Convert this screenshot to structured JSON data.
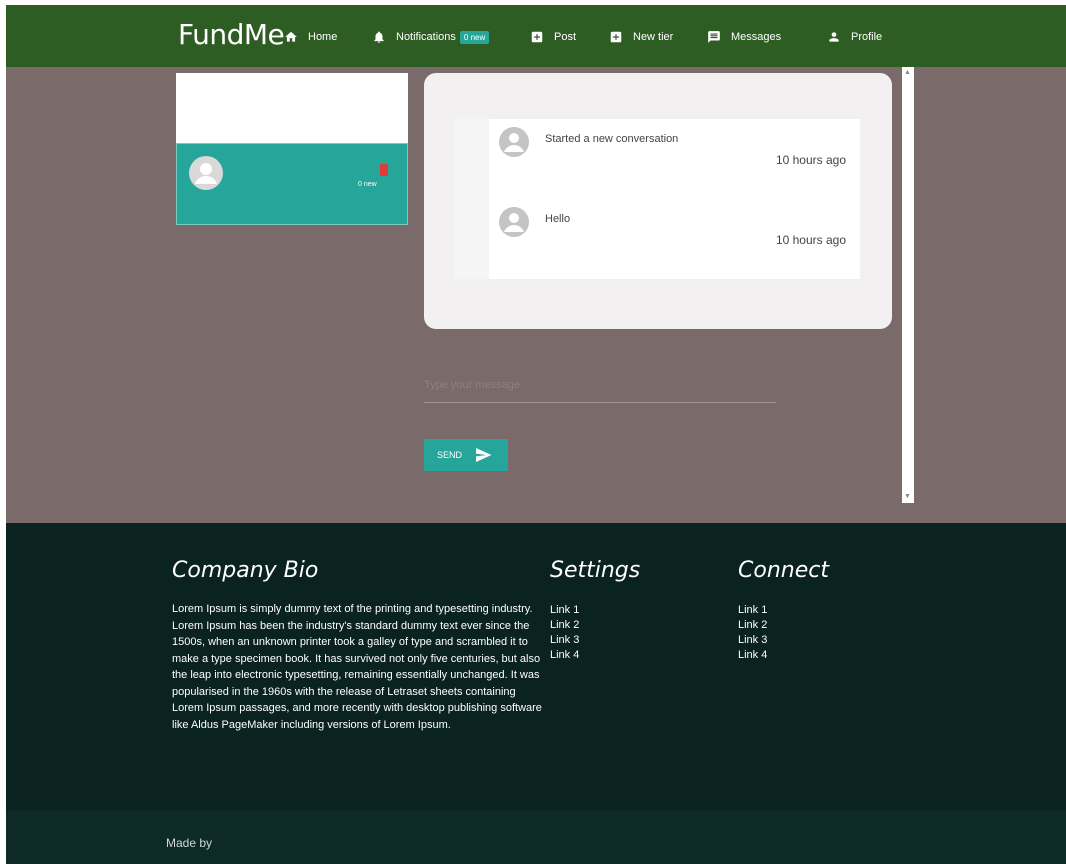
{
  "navbar": {
    "brand": "FundMe",
    "items": [
      {
        "label": "Home",
        "icon": "home-icon"
      },
      {
        "label": "Notifications",
        "icon": "bell-icon",
        "badge": "0 new"
      },
      {
        "label": "Post",
        "icon": "add-box-icon"
      },
      {
        "label": "New tier",
        "icon": "add-box-icon"
      },
      {
        "label": "Messages",
        "icon": "message-icon"
      },
      {
        "label": "Profile",
        "icon": "person-icon"
      }
    ]
  },
  "sidebar": {
    "conversation": {
      "name": "",
      "badge": "0 new"
    }
  },
  "chat": {
    "messages": [
      {
        "text": "Started a new conversation",
        "time": "10 hours ago"
      },
      {
        "text": "Hello",
        "time": "10 hours ago"
      }
    ],
    "input_placeholder": "Type your message",
    "send_label": "SEND"
  },
  "footer": {
    "bio_title": "Company Bio",
    "bio_text": "Lorem Ipsum is simply dummy text of the printing and typesetting industry. Lorem Ipsum has been the industry's standard dummy text ever since the 1500s, when an unknown printer took a galley of type and scrambled it to make a type specimen book. It has survived not only five centuries, but also the leap into electronic typesetting, remaining essentially unchanged. It was popularised in the 1960s with the release of Letraset sheets containing Lorem Ipsum passages, and more recently with desktop publishing software like Aldus PageMaker including versions of Lorem Ipsum.",
    "settings_title": "Settings",
    "settings_links": [
      "Link 1",
      "Link 2",
      "Link 3",
      "Link 4"
    ],
    "connect_title": "Connect",
    "connect_links": [
      "Link 1",
      "Link 2",
      "Link 3",
      "Link 4"
    ],
    "made_by": "Made by"
  },
  "colors": {
    "navbar": "#2e5d24",
    "background": "#7a6a6a",
    "accent": "#26a69a",
    "footer": "#0a2220"
  }
}
